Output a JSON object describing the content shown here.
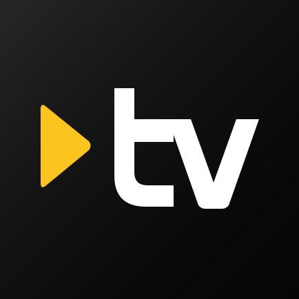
{
  "app_icon": {
    "logo": {
      "icon_name": "play-triangle-icon",
      "wordmark": "tv",
      "colors": {
        "background": "#000000",
        "play_triangle": "#FCC41F",
        "wordmark": "#FFFFFF"
      }
    }
  }
}
